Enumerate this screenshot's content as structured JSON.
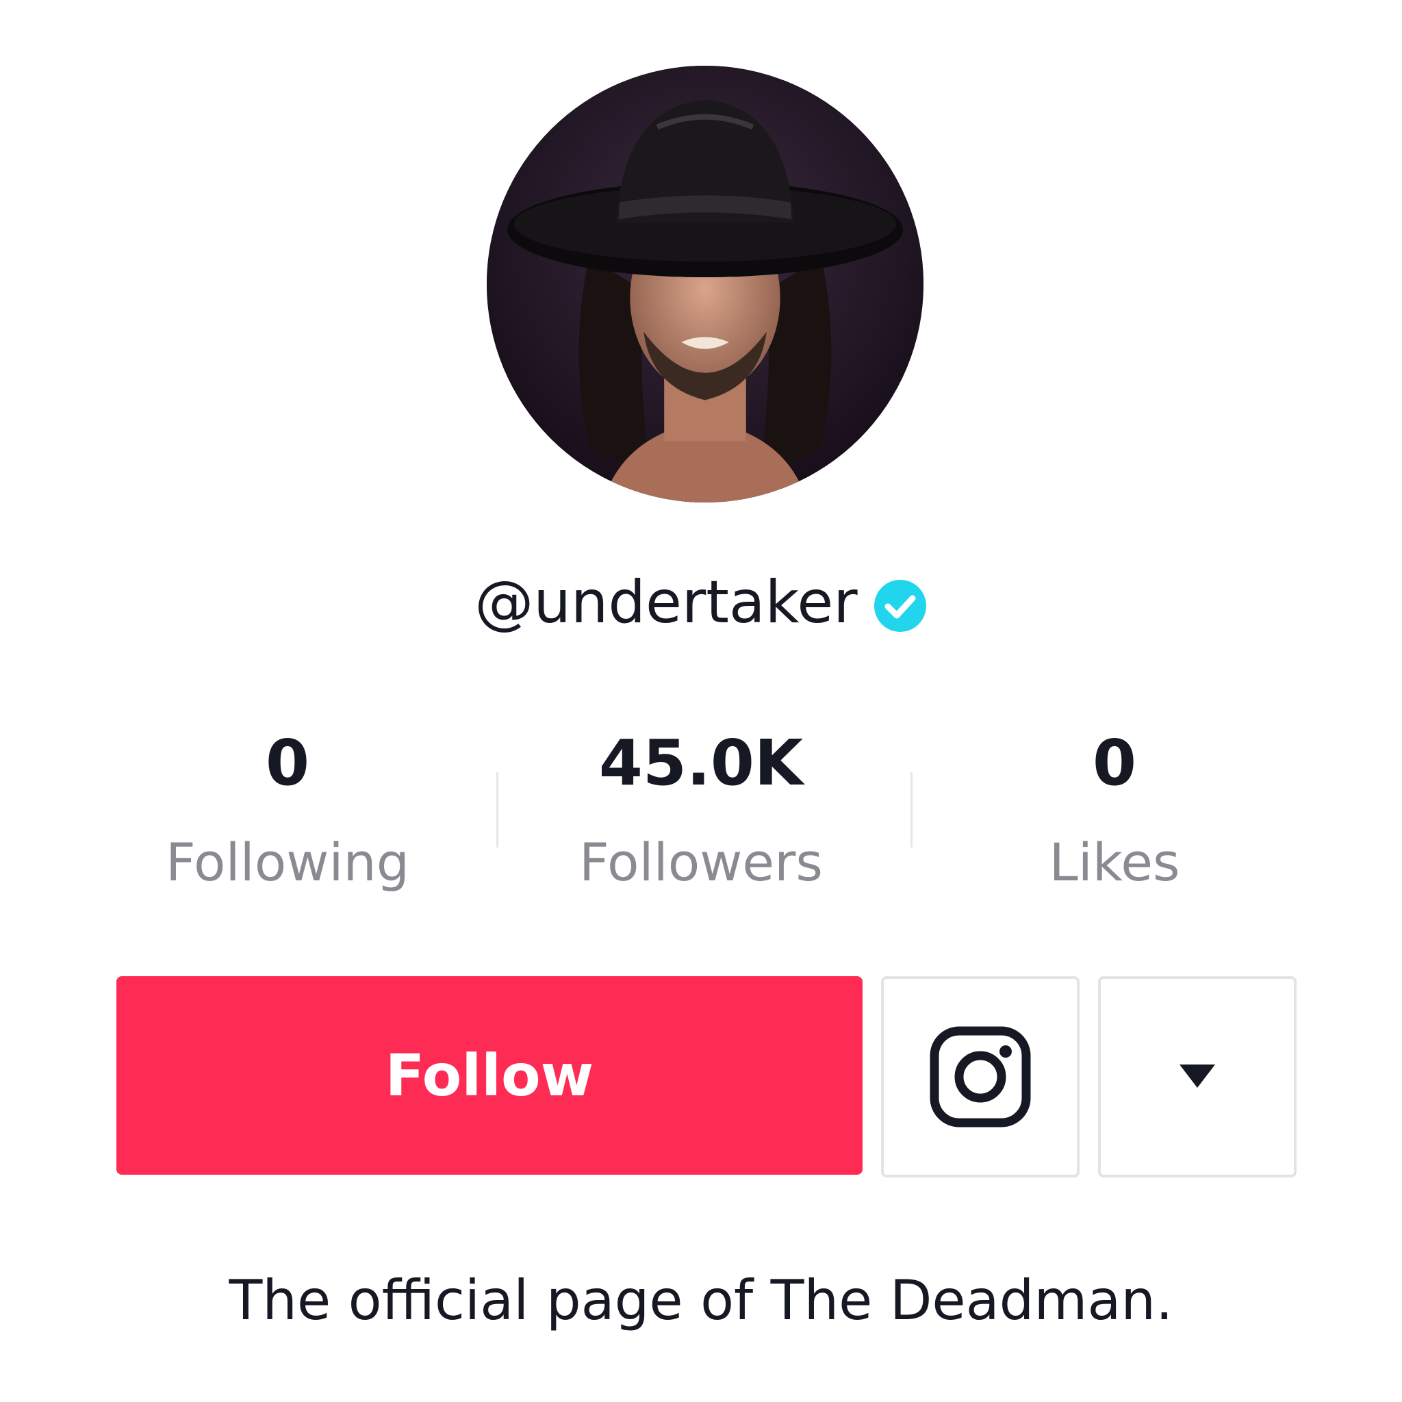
{
  "profile": {
    "username": "@undertaker",
    "verified_icon": "verified-badge-icon",
    "bio": "The official page of The Deadman."
  },
  "stats": [
    {
      "value": "0",
      "label": "Following"
    },
    {
      "value": "45.0K",
      "label": "Followers"
    },
    {
      "value": "0",
      "label": "Likes"
    }
  ],
  "actions": {
    "follow_label": "Follow",
    "instagram_icon": "instagram-icon",
    "more_icon": "caret-down-icon"
  },
  "colors": {
    "follow_button": "#fe2c55",
    "verified_badge": "#20d5ec",
    "text_primary": "#161823",
    "text_secondary": "#8a8b91",
    "border": "#e3e3e4"
  }
}
